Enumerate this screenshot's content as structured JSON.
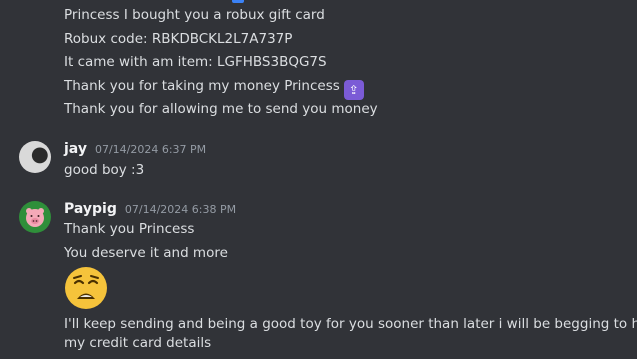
{
  "messages_top": [
    "Princess I bought you a robux gift card",
    "Robux code: RBKDBCKL2L7A737P",
    "It came with am item: LGFHBS3BQG7S",
    "Thank you for taking my money Princess",
    "Thank you for allowing me to send you money"
  ],
  "top_emoji_icon": "hands-raised-emoji",
  "jay": {
    "username": "jay",
    "timestamp": "07/14/2024 6:37 PM",
    "message": "good boy :3"
  },
  "paypig": {
    "username": "Paypig",
    "timestamp": "07/14/2024 6:38 PM",
    "message_1": "Thank you Princess",
    "message_2": "You deserve it and more",
    "big_emoji_icon": "weary-face-emoji",
    "message_3_line1": "I'll keep sending and being a good toy for you sooner than later i will be begging to have",
    "message_3_line2": "my credit card details"
  },
  "colors": {
    "background": "#313338",
    "text": "#dbdee1",
    "username": "#f2f3f5",
    "timestamp": "#949ba4"
  }
}
